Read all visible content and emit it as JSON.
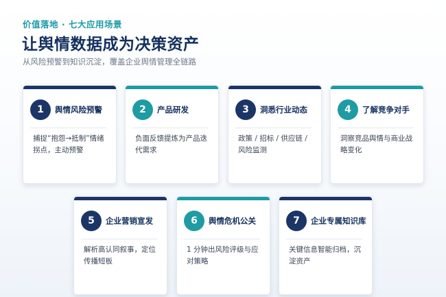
{
  "header": {
    "eyebrow": "价值落地 · 七大应用场景",
    "title": "让舆情数据成为决策资产",
    "subtitle": "从风险预警到知识沉淀，覆盖企业舆情管理全链路"
  },
  "cards": [
    {
      "number": "1",
      "title": "舆情风险预警",
      "desc": "捕捉“抱怨→抵制”情绪拐点，主动预警",
      "accent": "#1b3567"
    },
    {
      "number": "2",
      "title": "产品研发",
      "desc": "负面反馈提炼为产品迭代需求",
      "accent": "#1f9ba3"
    },
    {
      "number": "3",
      "title": "洞悉行业动态",
      "desc": "政策 / 招标 / 供应链 / 风险监测",
      "accent": "#1b3567"
    },
    {
      "number": "4",
      "title": "了解竞争对手",
      "desc": "洞察竞品舆情与商业战略变化",
      "accent": "#1f9ba3"
    },
    {
      "number": "5",
      "title": "企业营销宣发",
      "desc": "解析高认同叙事，定位传播短板",
      "accent": "#1b3567"
    },
    {
      "number": "6",
      "title": "舆情危机公关",
      "desc": "1 分钟出风险评级与应对策略",
      "accent": "#1f9ba3"
    },
    {
      "number": "7",
      "title": "企业专属知识库",
      "desc": "关键信息智能归档，沉淀资产",
      "accent": "#1b3567"
    }
  ]
}
